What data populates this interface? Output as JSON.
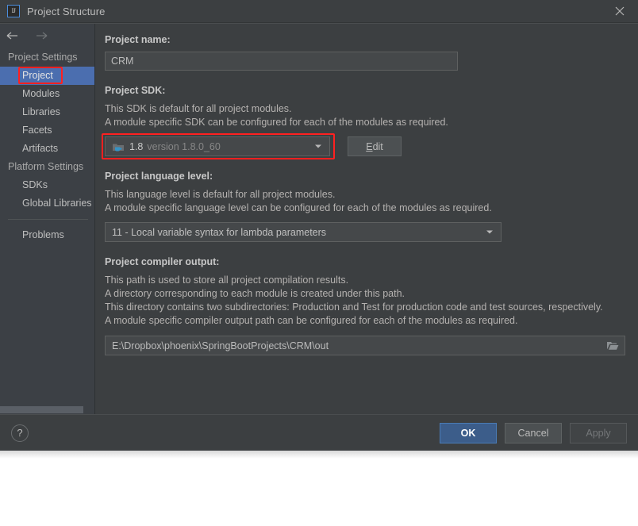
{
  "window": {
    "title": "Project Structure",
    "app_icon": "intellij-idea-icon",
    "close_icon": "close-icon"
  },
  "sidebar": {
    "back_icon": "arrow-left-icon",
    "forward_icon": "arrow-right-icon",
    "groups": [
      {
        "label": "Project Settings",
        "items": [
          {
            "label": "Project",
            "selected": true,
            "annotated": true
          },
          {
            "label": "Modules",
            "selected": false
          },
          {
            "label": "Libraries",
            "selected": false
          },
          {
            "label": "Facets",
            "selected": false
          },
          {
            "label": "Artifacts",
            "selected": false
          }
        ]
      },
      {
        "label": "Platform Settings",
        "items": [
          {
            "label": "SDKs",
            "selected": false
          },
          {
            "label": "Global Libraries",
            "selected": false
          }
        ]
      }
    ],
    "problems_label": "Problems"
  },
  "main": {
    "project_name": {
      "title": "Project name:",
      "value": "CRM"
    },
    "project_sdk": {
      "title": "Project SDK:",
      "desc_line1": "This SDK is default for all project modules.",
      "desc_line2": "A module specific SDK can be configured for each of the modules as required.",
      "sdk_icon": "jdk-icon",
      "sdk_name": "1.8",
      "sdk_version": "version 1.8.0_60",
      "dropdown_icon": "chevron-down-icon",
      "edit_button": {
        "prefix": "E",
        "rest": "dit"
      }
    },
    "language_level": {
      "title": "Project language level:",
      "desc_line1": "This language level is default for all project modules.",
      "desc_line2": "A module specific language level can be configured for each of the modules as required.",
      "value": "11 - Local variable syntax for lambda parameters",
      "dropdown_icon": "chevron-down-icon"
    },
    "compiler_output": {
      "title": "Project compiler output:",
      "desc_line1": "This path is used to store all project compilation results.",
      "desc_line2": "A directory corresponding to each module is created under this path.",
      "desc_line3": "This directory contains two subdirectories: Production and Test for production code and test sources, respectively.",
      "desc_line4": "A module specific compiler output path can be configured for each of the modules as required.",
      "value": "E:\\Dropbox\\phoenix\\SpringBootProjects\\CRM\\out",
      "browse_icon": "folder-open-icon"
    }
  },
  "footer": {
    "help_label": "?",
    "ok_label": "OK",
    "cancel_label": "Cancel",
    "apply_label": "Apply"
  },
  "colors": {
    "dialog_bg": "#3c3f41",
    "sidebar_bg": "#3c4045",
    "selection_blue": "#4b6eaf",
    "annotation_red": "#ff2020",
    "primary_button": "#3c5d8a",
    "field_bg": "#45484a"
  }
}
